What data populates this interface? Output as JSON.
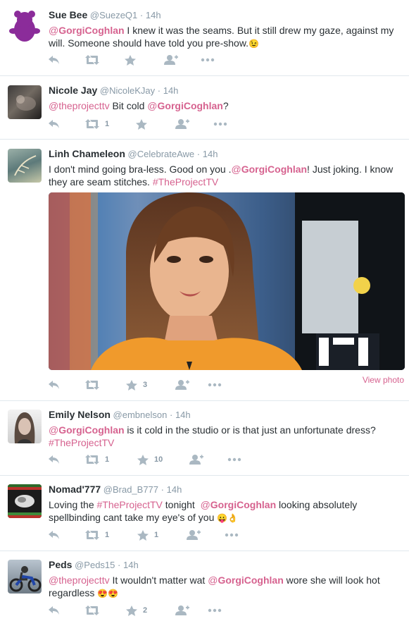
{
  "tweets": [
    {
      "name": "Sue Bee",
      "handle": "@SuezeQ1",
      "time": "14h",
      "t1": "",
      "m1": "@GorgiCoghlan",
      "t2": " I knew it was the seams. But it still drew my gaze, against  my will.  Someone should have  told you pre-show.",
      "emoji": "😉",
      "retweets": "",
      "likes": ""
    },
    {
      "name": "Nicole Jay",
      "handle": "@NicoleKJay",
      "time": "14h",
      "m0": "@theprojecttv",
      "t1": " Bit cold ",
      "m1": "@GorgiCoghlan",
      "t2": "?",
      "retweets": "1",
      "likes": ""
    },
    {
      "name": "Linh Chameleon",
      "handle": "@CelebrateAwe",
      "time": "14h",
      "t1": "I don't mind going bra-less. Good on you .",
      "m1": "@GorgiCoghlan",
      "t2": "! Just joking. I know they are seam stitches. ",
      "hashtag": "#TheProjectTV",
      "retweets": "",
      "likes": "3",
      "view_photo": "View photo"
    },
    {
      "name": "Emily Nelson",
      "handle": "@embnelson",
      "time": "14h",
      "m1": "@GorgiCoghlan",
      "t2": " is it cold in the studio or is that just an unfortunate dress?",
      "hashtag": "#TheProjectTV",
      "retweets": "1",
      "likes": "10"
    },
    {
      "name": "Nomad'777",
      "handle": "@Brad_B777",
      "time": "14h",
      "t1": "Loving the ",
      "hashtag": "#TheProjectTV",
      "t_mid": " tonight  ",
      "m1": "@GorgiCoghlan",
      "t2": " looking absolutely spellbinding cant take my eye's of you ",
      "emoji": "😛👌",
      "retweets": "1",
      "likes": "1"
    },
    {
      "name": "Peds",
      "handle": "@Peds15",
      "time": "14h",
      "m0": "@theprojecttv",
      "t1": " It wouldn't matter wat ",
      "m1": "@GorgiCoghlan",
      "t2": " wore she will look hot regardless ",
      "emoji": "😍😍",
      "retweets": "",
      "likes": "2"
    }
  ],
  "dot": "·",
  "colors": {
    "accent": "#d6628f",
    "muted": "#8899a6",
    "icon": "#aab8c2"
  }
}
